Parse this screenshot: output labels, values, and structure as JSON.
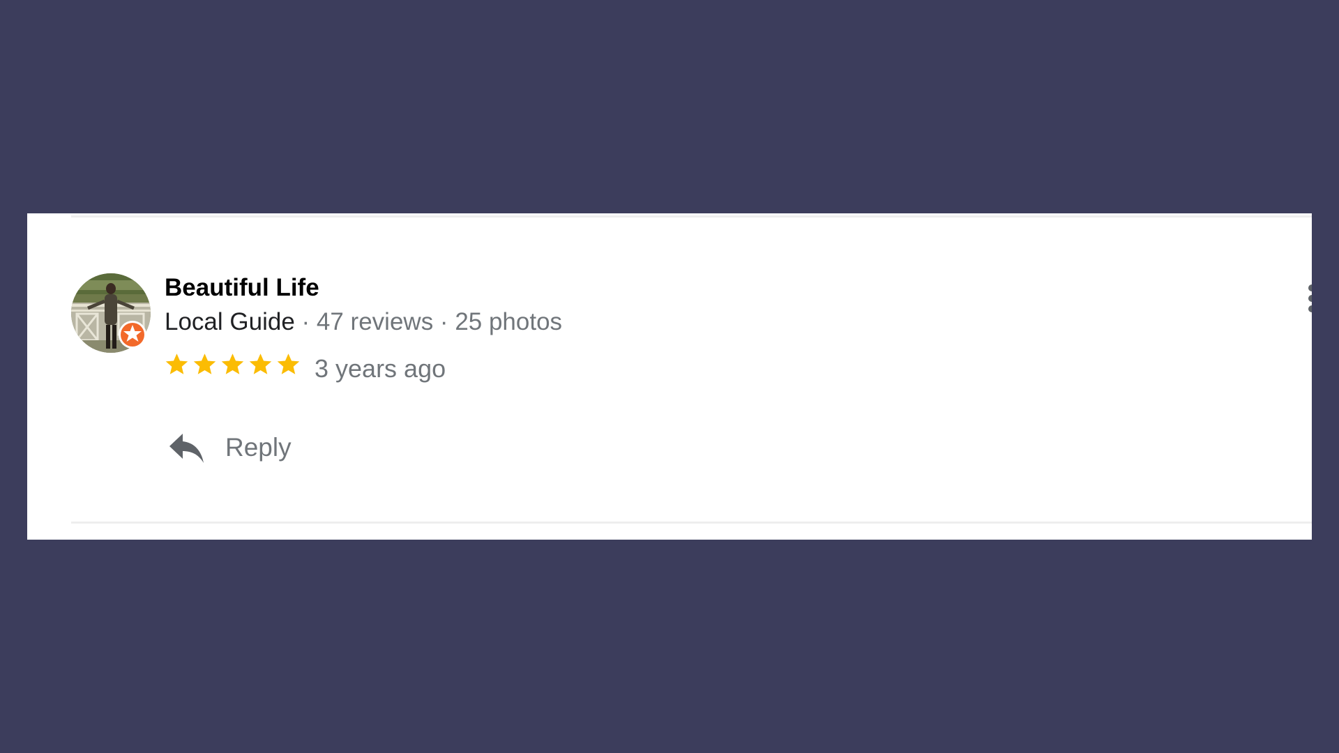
{
  "review": {
    "author": "Beautiful Life",
    "author_badge": "Local Guide",
    "separator": " · ",
    "reviews_count": "47 reviews",
    "photos_count": "25 photos",
    "rating": 5,
    "rating_max": 5,
    "time": "3 years ago",
    "reply_label": "Reply"
  },
  "icons": {
    "badge": "local-guide-star-icon",
    "rating": "star-icon",
    "reply": "reply-arrow-icon",
    "more": "more-vert-icon"
  },
  "colors": {
    "background": "#3c3d5c",
    "card": "#ffffff",
    "star": "#fbbc04",
    "badge": "#f2692a",
    "secondary_text": "#70757a"
  }
}
